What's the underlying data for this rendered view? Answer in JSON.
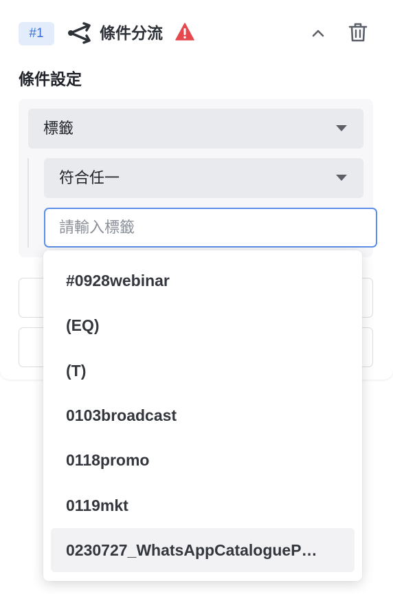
{
  "node": {
    "badge": "#1",
    "title": "條件分流",
    "icons": {
      "branch": "branch-arrows-icon",
      "warning": "warning-triangle-icon",
      "collapse": "chevron-up-icon",
      "delete": "trash-icon"
    },
    "colors": {
      "badge_bg": "#e3ecfb",
      "badge_text": "#3b6fd8",
      "warning": "#e5484d",
      "focus_border": "#5b8ee6"
    }
  },
  "conditions": {
    "section_title": "條件設定",
    "type_select": {
      "value": "標籤"
    },
    "match_select": {
      "value": "符合任一"
    },
    "tag_input": {
      "value": "",
      "placeholder": "請輸入標籤"
    }
  },
  "dropdown": {
    "options": [
      "#0928webinar",
      "(EQ)",
      "(T)",
      "0103broadcast",
      "0118promo",
      "0119mkt",
      "0230727_WhatsAppCatalogueP…"
    ],
    "hovered_index": 6
  }
}
